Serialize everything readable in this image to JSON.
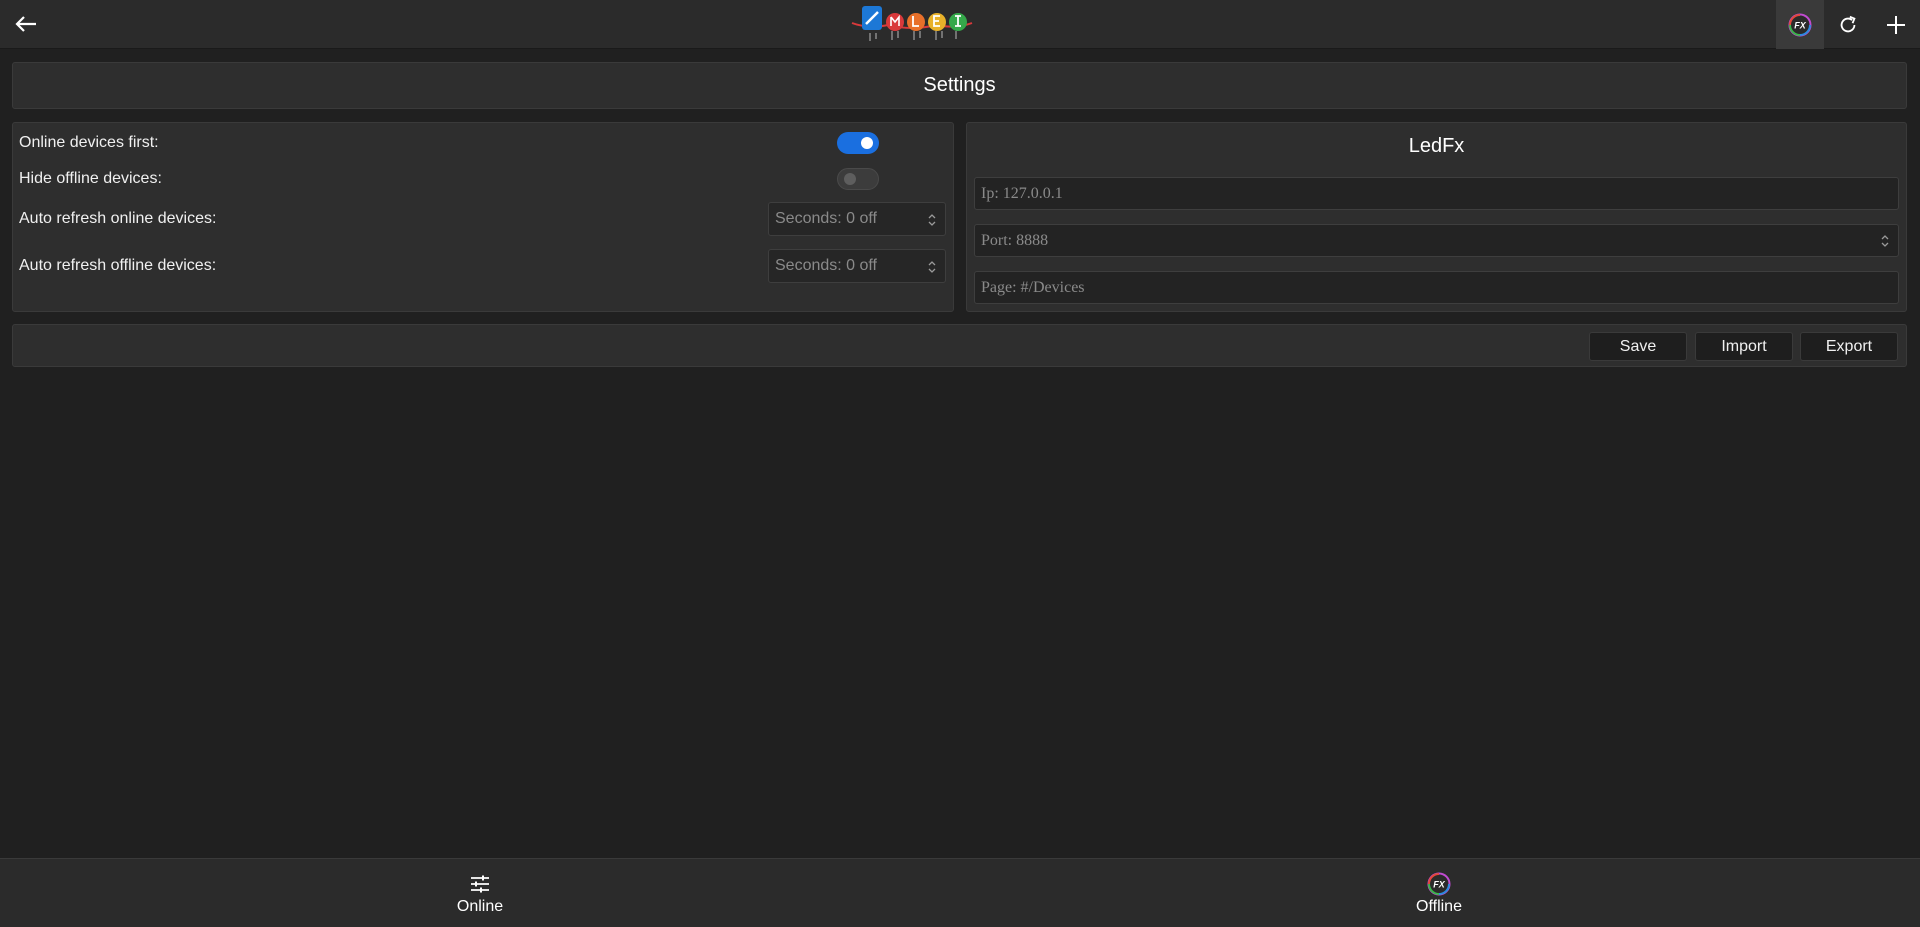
{
  "topbar": {
    "back_icon": "arrow-left-icon",
    "logo_name": "led-logo",
    "actions": [
      {
        "name": "ledfx-icon",
        "active": true
      },
      {
        "name": "refresh-icon",
        "active": false
      },
      {
        "name": "plus-icon",
        "active": false
      }
    ]
  },
  "settings": {
    "title": "Settings"
  },
  "options": {
    "online_first_label": "Online devices first:",
    "online_first_value": true,
    "hide_offline_label": "Hide offline devices:",
    "hide_offline_value": false,
    "auto_refresh_online_label": "Auto refresh online devices:",
    "auto_refresh_online_placeholder": "Seconds: 0 off",
    "auto_refresh_offline_label": "Auto refresh offline devices:",
    "auto_refresh_offline_placeholder": "Seconds: 0 off"
  },
  "ledfx": {
    "title": "LedFx",
    "ip_placeholder": "Ip: 127.0.0.1",
    "port_placeholder": "Port: 8888",
    "page_placeholder": "Page: #/Devices"
  },
  "actions": {
    "save_label": "Save",
    "import_label": "Import",
    "export_label": "Export"
  },
  "bottom_nav": {
    "online_label": "Online",
    "online_icon": "sliders-icon",
    "offline_label": "Offline",
    "offline_icon": "ledfx-icon"
  },
  "colors": {
    "accent": "#1a6fe0",
    "background": "#202020",
    "panel": "#2e2e2e"
  }
}
